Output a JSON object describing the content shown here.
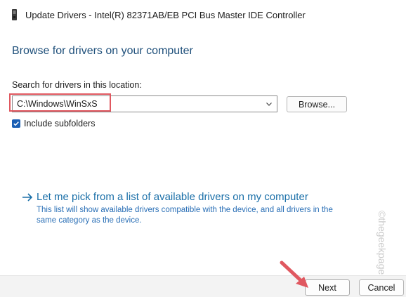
{
  "window": {
    "title": "Update Drivers - Intel(R) 82371AB/EB PCI Bus Master IDE Controller",
    "icon": "device-icon"
  },
  "page": {
    "heading": "Browse for drivers on your computer",
    "search_label": "Search for drivers in this location:",
    "path_value": "C:\\Windows\\WinSxS",
    "browse_label": "Browse...",
    "include_subfolders_label": "Include subfolders",
    "include_subfolders_checked": true
  },
  "pick": {
    "link_text": "Let me pick from a list of available drivers on my computer",
    "description": "This list will show available drivers compatible with the device, and all drivers in the same category as the device."
  },
  "watermark": "©thegeekpage.com",
  "footer": {
    "next_label": "Next",
    "cancel_label": "Cancel"
  },
  "colors": {
    "accent": "#1a5fb4",
    "link": "#1a6fa8",
    "heading": "#1e4f7a",
    "annotation_red": "#e05860"
  }
}
